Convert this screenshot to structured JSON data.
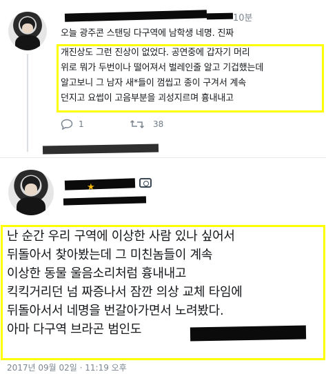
{
  "tweet1": {
    "time": "10분",
    "line1": "오늘 광주콘 스탠딩 다구역에 남학생 네명. 진짜",
    "line2": "개진상도 그런 진상이 없었다. 공연중에 갑자기 머리",
    "line3": "위로 뭐가 두번이나 떨어져서 벌레인줄 알고 기겁했는데",
    "line4": "알고보니 그 남자 새*들이 껌씹고 종이 구겨서 계속",
    "line5": "던지고 요썹이 고음부분을 괴성지르며 흉내내고",
    "reply_count": "1",
    "retweet_count": "38"
  },
  "tweet2": {
    "line1": "난 순간 우리 구역에 이상한 사람 있나 싶어서",
    "line2": "뒤돌아서 찾아봤는데 그 미친놈들이 계속",
    "line3": "이상한 동물 울음소리처럼 흉내내고",
    "line4": "킥킥거리던 넘 짜증나서 잠깐 의상 교체 타임에",
    "line5": "뒤돌아서서 네명을 번갈아가면서 노려봤다.",
    "line6": "아마 다구역 브라곤 범인도",
    "timestamp": "2017년 09월 02일 · 11:19 오후"
  },
  "icons": {
    "reply": "reply-icon",
    "retweet": "retweet-icon",
    "camera": "camera-icon",
    "star": "star-icon"
  },
  "colors": {
    "highlight": "#ffff00",
    "meta_gray": "#7a8590",
    "redaction": "#0b0b0b"
  }
}
